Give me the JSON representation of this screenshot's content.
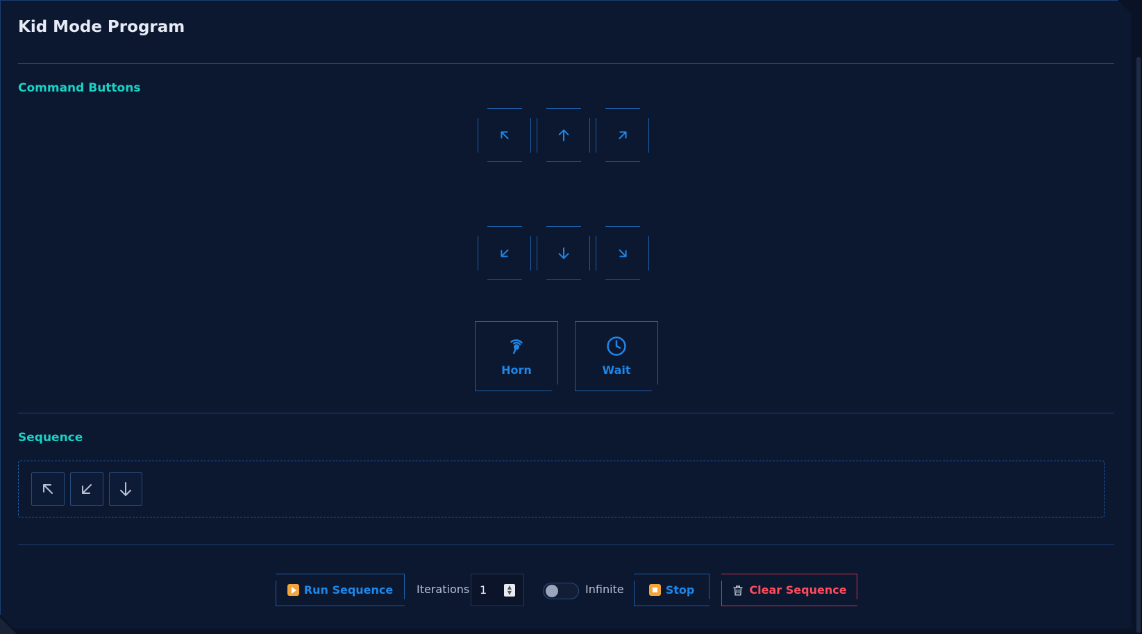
{
  "title": "Kid Mode Program",
  "sections": {
    "commands_label": "Command Buttons",
    "sequence_label": "Sequence"
  },
  "commands": {
    "directions_top": [
      "up-left-arrow-icon",
      "up-arrow-icon",
      "up-right-arrow-icon"
    ],
    "directions_bottom": [
      "down-left-arrow-icon",
      "down-arrow-icon",
      "down-right-arrow-icon"
    ],
    "horn_label": "Horn",
    "wait_label": "Wait"
  },
  "sequence": {
    "items": [
      "up-left-arrow-icon",
      "down-left-arrow-icon",
      "down-arrow-icon"
    ]
  },
  "controls": {
    "run_label": "Run Sequence",
    "iterations_label": "Iterations",
    "iterations_value": "1",
    "infinite_label": "Infinite",
    "infinite_on": false,
    "stop_label": "Stop",
    "clear_label": "Clear Sequence"
  },
  "colors": {
    "background": "#0c1730",
    "accent": "#1e87e8",
    "section": "#19d3c5",
    "danger": "#ff4d5e"
  }
}
